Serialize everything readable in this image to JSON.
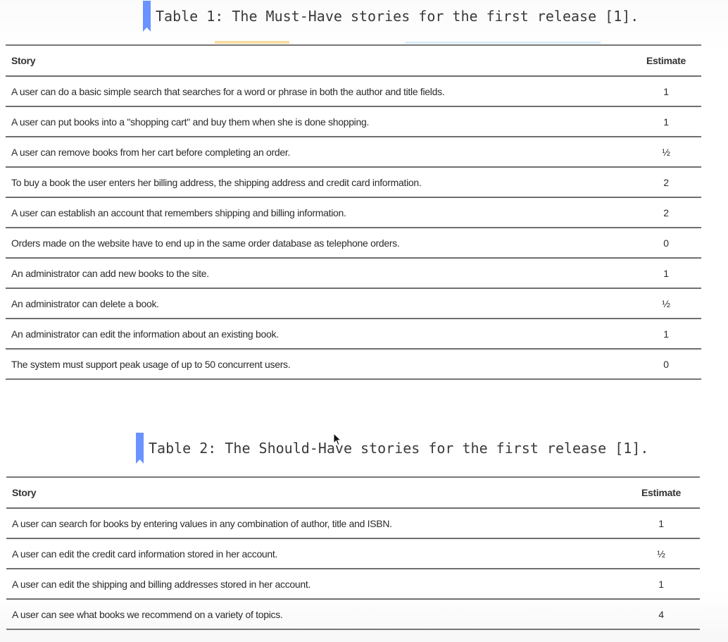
{
  "tables": [
    {
      "caption": "Table 1: The Must-Have stories for the first release [1].",
      "headers": {
        "story": "Story",
        "estimate": "Estimate"
      },
      "rows": [
        {
          "story": "A user can do a basic simple search that searches for a word or phrase in both the author and title fields.",
          "estimate": "1"
        },
        {
          "story": "A user can put books into a \"shopping cart\" and buy them when she is done shopping.",
          "estimate": "1"
        },
        {
          "story": "A user can remove books from her cart before completing an order.",
          "estimate": "½"
        },
        {
          "story": "To buy a book the user enters her billing address, the shipping address and credit card information.",
          "estimate": "2"
        },
        {
          "story": "A user can establish an account that remembers shipping and billing information.",
          "estimate": "2"
        },
        {
          "story": "Orders made on the website have to end up in the same order database as telephone orders.",
          "estimate": "0"
        },
        {
          "story": "An administrator can add new books to the site.",
          "estimate": "1"
        },
        {
          "story": "An administrator can delete a book.",
          "estimate": "½"
        },
        {
          "story": "An administrator can edit the information about an existing book.",
          "estimate": "1"
        },
        {
          "story": "The system must support peak usage of up to 50 concurrent users.",
          "estimate": "0"
        }
      ]
    },
    {
      "caption": "Table 2: The Should-Have stories for the first release [1].",
      "headers": {
        "story": "Story",
        "estimate": "Estimate"
      },
      "rows": [
        {
          "story": "A user can search for books by entering values in any combination of author, title and ISBN.",
          "estimate": "1"
        },
        {
          "story": "A user can edit the credit card information stored in her account.",
          "estimate": "½"
        },
        {
          "story": "A user can edit the shipping and billing addresses stored in her account.",
          "estimate": "1"
        },
        {
          "story": "A user can see what books we recommend on a variety of topics.",
          "estimate": "4"
        }
      ]
    }
  ],
  "colors": {
    "caption_marker": "#6a93ff",
    "rule": "#6f6f6f",
    "text": "#2b2b2b"
  }
}
